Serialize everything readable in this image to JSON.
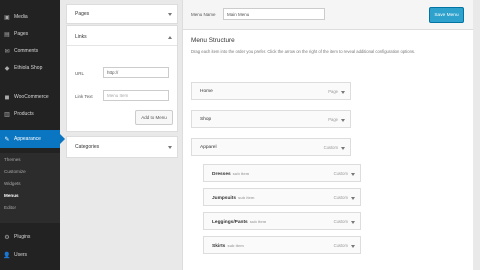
{
  "sidebar": {
    "items": [
      {
        "icon": "media-icon",
        "glyph": "▣",
        "label": "Media"
      },
      {
        "icon": "pages-icon",
        "glyph": "▤",
        "label": "Pages"
      },
      {
        "icon": "comments-icon",
        "glyph": "✉",
        "label": "Comments"
      },
      {
        "icon": "store-icon",
        "glyph": "◆",
        "label": "Ethiola Shop"
      },
      {
        "icon": "woocommerce-icon",
        "glyph": "◼",
        "label": "WooCommerce"
      },
      {
        "icon": "products-icon",
        "glyph": "▥",
        "label": "Products"
      },
      {
        "icon": "appearance-icon",
        "glyph": "✎",
        "label": "Appearance"
      },
      {
        "icon": "plugins-icon",
        "glyph": "⚙",
        "label": "Plugins"
      },
      {
        "icon": "users-icon",
        "glyph": "👤",
        "label": "Users"
      }
    ],
    "submenu": [
      "Themes",
      "Customize",
      "Widgets",
      "Menus",
      "Editor"
    ]
  },
  "left_column": {
    "pages_title": "Pages",
    "links_title": "Links",
    "url_label": "URL",
    "url_value": "http://",
    "link_text_label": "Link Text",
    "link_text_placeholder": "Menu Item",
    "add_to_menu": "Add to Menu",
    "categories_title": "Categories"
  },
  "main": {
    "menu_name_label": "Menu Name",
    "menu_name_value": "Main Menu",
    "save_button": "Save Menu",
    "structure_title": "Menu Structure",
    "instructions": "Drag each item into the order you prefer. Click the arrow on the right of the item to reveal additional configuration options.",
    "items": [
      {
        "label": "Home",
        "sub": "",
        "type": "Page"
      },
      {
        "label": "Shop",
        "sub": "",
        "type": "Page"
      },
      {
        "label": "Apparel",
        "sub": "",
        "type": "Custom"
      },
      {
        "label": "Dresses",
        "sub": "sub item",
        "type": "Custom"
      },
      {
        "label": "Jumpsuits",
        "sub": "sub item",
        "type": "Custom"
      },
      {
        "label": "Leggings/Pants",
        "sub": "sub item",
        "type": "Custom"
      },
      {
        "label": "Skirts",
        "sub": "sub item",
        "type": "Custom"
      }
    ]
  }
}
